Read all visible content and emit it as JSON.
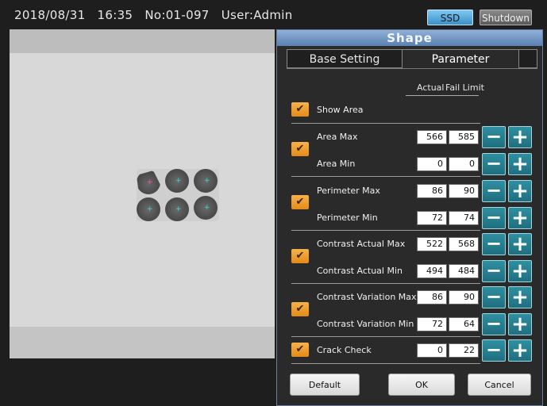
{
  "topbar": {
    "date": "2018/08/31",
    "time": "16:35",
    "number": "No:01-097",
    "user": "User:Admin",
    "ssd_label": "SSD",
    "shutdown_label": "Shutdown"
  },
  "panel": {
    "title": "Shape",
    "tabs": {
      "base": "Base Setting",
      "parameter": "Parameter"
    },
    "headers": {
      "actual": "Actual",
      "fail_limit": "Fail Limit"
    },
    "show_area": {
      "label": "Show Area",
      "checked": true
    },
    "rows": {
      "area_max": {
        "label": "Area Max",
        "actual": "566",
        "limit": "585"
      },
      "area_min": {
        "label": "Area Min",
        "actual": "0",
        "limit": "0"
      },
      "perimeter_max": {
        "label": "Perimeter Max",
        "actual": "86",
        "limit": "90"
      },
      "perimeter_min": {
        "label": "Perimeter Min",
        "actual": "72",
        "limit": "74"
      },
      "contrast_actual_max": {
        "label": "Contrast Actual Max",
        "actual": "522",
        "limit": "568"
      },
      "contrast_actual_min": {
        "label": "Contrast Actual Min",
        "actual": "494",
        "limit": "484"
      },
      "contrast_variation_max": {
        "label": "Contrast Variation Max",
        "actual": "86",
        "limit": "90"
      },
      "contrast_variation_min": {
        "label": "Contrast Variation Min",
        "actual": "72",
        "limit": "64"
      },
      "crack_check": {
        "label": "Crack Check",
        "actual": "0",
        "limit": "22"
      }
    },
    "icons": {
      "check": "✔",
      "minus": "−",
      "plus": "+"
    },
    "buttons": {
      "default": "Default",
      "ok": "OK",
      "cancel": "Cancel"
    }
  },
  "colors": {
    "accent_checkbox": "#e58a17",
    "stepper": "#1f6f80",
    "title_bar": "#5b80b0",
    "ssd": "#3b8fc9"
  }
}
